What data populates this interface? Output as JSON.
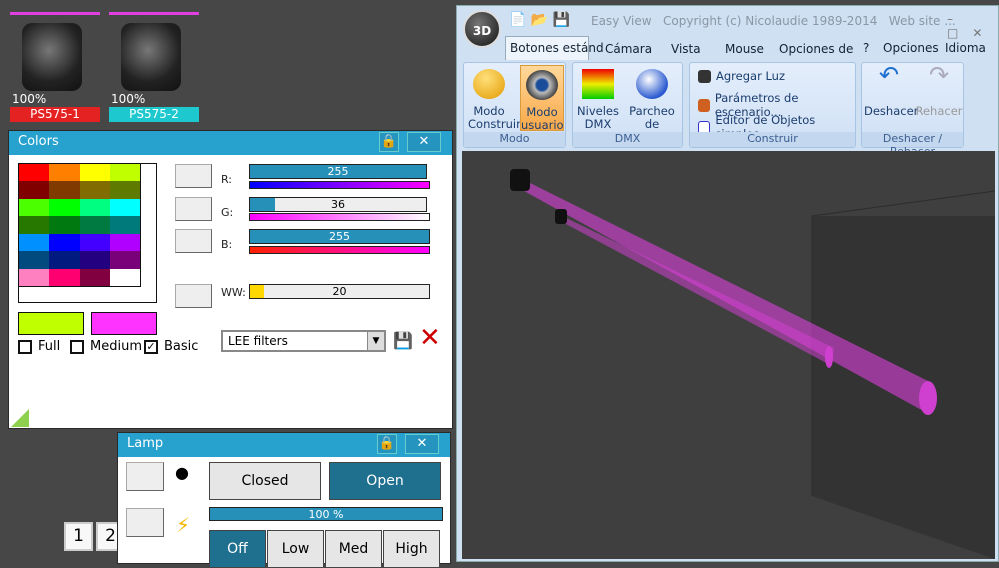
{
  "fixtures": [
    {
      "label": "PS575-1",
      "level": "100%",
      "color": "#e52222"
    },
    {
      "label": "PS575-2",
      "level": "100%",
      "color": "#1ec8cf"
    }
  ],
  "colors_window": {
    "title": "Colors",
    "palette": [
      [
        "#ff0000",
        "#ff8000",
        "#ffff00",
        "#c0ff00"
      ],
      [
        "#800000",
        "#803a00",
        "#806c00",
        "#5e7b00"
      ],
      [
        "#4cff00",
        "#00ff00",
        "#00ff80",
        "#00ffff"
      ],
      [
        "#267800",
        "#007a10",
        "#007a40",
        "#007a7a"
      ],
      [
        "#0090ff",
        "#0000ff",
        "#4400ff",
        "#b000ff"
      ],
      [
        "#004a80",
        "#001a80",
        "#220080",
        "#7a007a"
      ],
      [
        "#ff80c0",
        "#ff0070",
        "#800040",
        "#ffffff"
      ]
    ],
    "sliders": [
      {
        "label": "R:",
        "value": 255,
        "max": 255
      },
      {
        "label": "G:",
        "value": 36,
        "max": 255
      },
      {
        "label": "B:",
        "value": 255,
        "max": 255
      },
      {
        "label": "WW:",
        "value": 20,
        "max": 255
      }
    ],
    "current_colors": [
      "#c0ff00",
      "#ff33ff"
    ],
    "checkboxes": [
      {
        "label": "Full",
        "checked": false
      },
      {
        "label": "Medium",
        "checked": false
      },
      {
        "label": "Basic",
        "checked": true
      }
    ],
    "filter_select": "LEE filters",
    "presets": [
      "1",
      "2"
    ],
    "swatches": [
      "#e50000",
      "#10e010",
      "#0000ff",
      "#fbe82a",
      "#00ffff",
      "#ff00ff",
      "#000000"
    ]
  },
  "lamp_window": {
    "title": "Lamp",
    "closed": "Closed",
    "open": "Open",
    "level": "100 %",
    "level_value": 100,
    "modes": [
      "Off",
      "Low",
      "Med",
      "High"
    ],
    "active_mode": "Off"
  },
  "easyview": {
    "title": "Easy View   Copyright (c) Nicolaudie 1989-2014   Web site ...",
    "logo": "3D",
    "tabs": [
      "Botones estánd",
      "Cámara",
      "Vista",
      "Mouse",
      "Opciones de re"
    ],
    "menus": [
      "?",
      "Opciones",
      "Idioma"
    ],
    "groups": {
      "modo": "Modo",
      "dmx": "DMX",
      "construir": "Construir",
      "undo": "Deshacer / Rehacer"
    },
    "buttons": {
      "modo_construir": "Modo Construir",
      "modo_usuario": "Modo usuario",
      "niveles": "Niveles DMX",
      "parcheo": "Parcheo de Universos",
      "deshacer": "Deshacer",
      "rehacer": "Rehacer"
    },
    "construir_items": [
      "Agregar Luz",
      "Parámetros de escenario...",
      "Editor de Objetos simples"
    ],
    "beam_color": "#d040d0"
  }
}
